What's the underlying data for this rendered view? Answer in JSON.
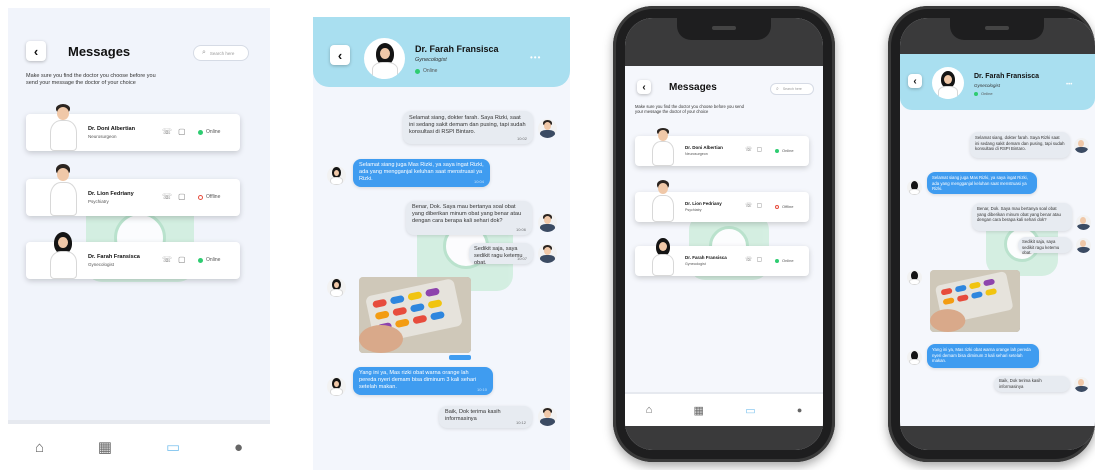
{
  "list_screen": {
    "title": "Messages",
    "search_placeholder": "Search here",
    "subtitle": "Make sure you find the doctor you choose before you send your message the doctor of your choice",
    "doctors": [
      {
        "name": "Dr. Doni Albertian",
        "specialty": "Neurosurgeon",
        "status": "Online",
        "status_color": "#2ecc71"
      },
      {
        "name": "Dr. Lion Fedriany",
        "specialty": "Psychiatry",
        "status": "Offline",
        "status_color": "#e74c3c"
      },
      {
        "name": "Dr. Farah Fransisca",
        "specialty": "Gynecologist",
        "status": "Online",
        "status_color": "#2ecc71"
      }
    ],
    "tabs": [
      "home",
      "calendar",
      "chat",
      "profile"
    ]
  },
  "chat_screen": {
    "doctor_name": "Dr. Farah Fransisca",
    "specialty": "Gynecologist",
    "status": "Online",
    "messages": [
      {
        "from": "user",
        "text": "Selamat siang, dokter farah. Saya Rizki, saat ini sedang sakit demam dan pusing, tapi sudah konsultasi di RSPI Bintaro.",
        "time": "10:02"
      },
      {
        "from": "doctor",
        "text": "Selamat siang juga Mas Rizki, ya saya ingat Rizki, ada yang mengganjal keluhan saat menstruasi ya Rizki.",
        "time": "10:04"
      },
      {
        "from": "user",
        "text": "Benar, Dok. Saya mau bertanya soal obat yang diberikan minum obat yang benar atau dengan cara berapa kali sehari dok?",
        "time": "10:06"
      },
      {
        "from": "user",
        "text": "Sedikit saja, saya sedikit ragu ketemu obat.",
        "time": "10:07"
      },
      {
        "from": "doctor",
        "type": "image",
        "time": "10:09"
      },
      {
        "from": "doctor",
        "text": "Yang ini ya, Mas rizki obat warna orange lah pereda nyeri demam bisa diminum 3 kali sehari setelah makan.",
        "time": "10:10"
      },
      {
        "from": "user",
        "text": "Baik, Dok terima kasih informasinya",
        "time": "10:12"
      }
    ],
    "tabs": [
      "home",
      "calendar",
      "chat",
      "profile"
    ]
  },
  "phone_list": {
    "title": "Messages",
    "search_placeholder": "Search here",
    "subtitle": "Make sure you find the doctor you choose before you send your message the doctor of your choice",
    "doctors": [
      {
        "name": "Dr. Doni Albertian",
        "specialty": "Neurosurgeon",
        "status": "Online",
        "status_color": "#2ecc71"
      },
      {
        "name": "Dr. Lion Fedriany",
        "specialty": "Psychiatry",
        "status": "Offline",
        "status_color": "#e74c3c"
      },
      {
        "name": "Dr. Farah Fransisca",
        "specialty": "Gynecologist",
        "status": "Online",
        "status_color": "#2ecc71"
      }
    ]
  },
  "phone_chat": {
    "doctor_name": "Dr. Farah Fransisca",
    "specialty": "Gynecologist",
    "status": "Online",
    "messages": [
      {
        "text": "Selamat siang, dokter farah. Saya Rizki saat ini sedang sakit demam dan pusing, tapi sudah konsultasi di RSPI Bintaro."
      },
      {
        "text": "Selamat siang juga Mas Rizki, ya saya ingat Rizki, ada yang mengganjal keluhan saat menstruasi ya Rizki."
      },
      {
        "text": "Benar, Dok. Saya mau bertanya soal obat yang diberikan minum obat yang benar atau dengan cara berapa kali sehari dok?"
      },
      {
        "text": "Sedikit saja, saya sedikit ragu ketemu obat."
      },
      {
        "text": "Yang ini ya, Mas rizki obat warna orange lah pereda nyeri demam bisa diminum 3 kali sehari setelah makan."
      },
      {
        "text": "Baik, Dok terima kasih informasinya"
      }
    ]
  },
  "icons": {
    "back": "‹",
    "search": "⌕",
    "more": "•••",
    "home": "⌂",
    "calendar": "▦",
    "chat": "▭",
    "profile": "●",
    "call": "☏",
    "video": "▢"
  },
  "colors": {
    "header_blue": "#a9dff0",
    "bubble_blue": "#3f9cf0",
    "bubble_gray": "#e7ebf1",
    "online": "#2ecc71",
    "offline": "#e74c3c",
    "chat_tab_active": "#7fc3ee"
  }
}
